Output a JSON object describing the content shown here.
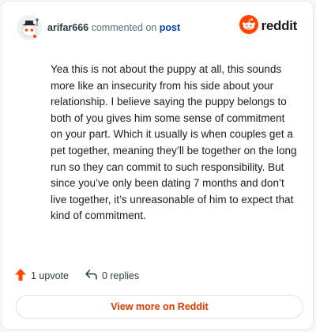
{
  "header": {
    "author": "arifar666",
    "commented_on": "commented on",
    "post_link": "post",
    "brand": "reddit",
    "avatar_icon": "snoo-avatar-icon",
    "brand_icon": "reddit-logo-icon"
  },
  "comment": {
    "text": "Yea this is not about the puppy at all, this sounds more like an insecurity from his side about your relationship. I believe saying the puppy belongs to both of you gives him some sense of commitment on your part. Which it usually is when couples get a pet together, meaning they’ll be together on the long run so they can commit to such responsibility. But since you’ve only been dating 7 months and don’t live together, it’s unreasonable of him to expect that kind of commitment."
  },
  "actions": {
    "upvotes": "1 upvote",
    "replies": "0 replies",
    "upvote_icon": "upvote-arrow-icon",
    "reply_icon": "reply-arrow-icon"
  },
  "footer": {
    "view_more": "View more on Reddit"
  },
  "colors": {
    "accent": "#ff4500",
    "link": "#0045ac",
    "view_more_text": "#d93a00"
  }
}
